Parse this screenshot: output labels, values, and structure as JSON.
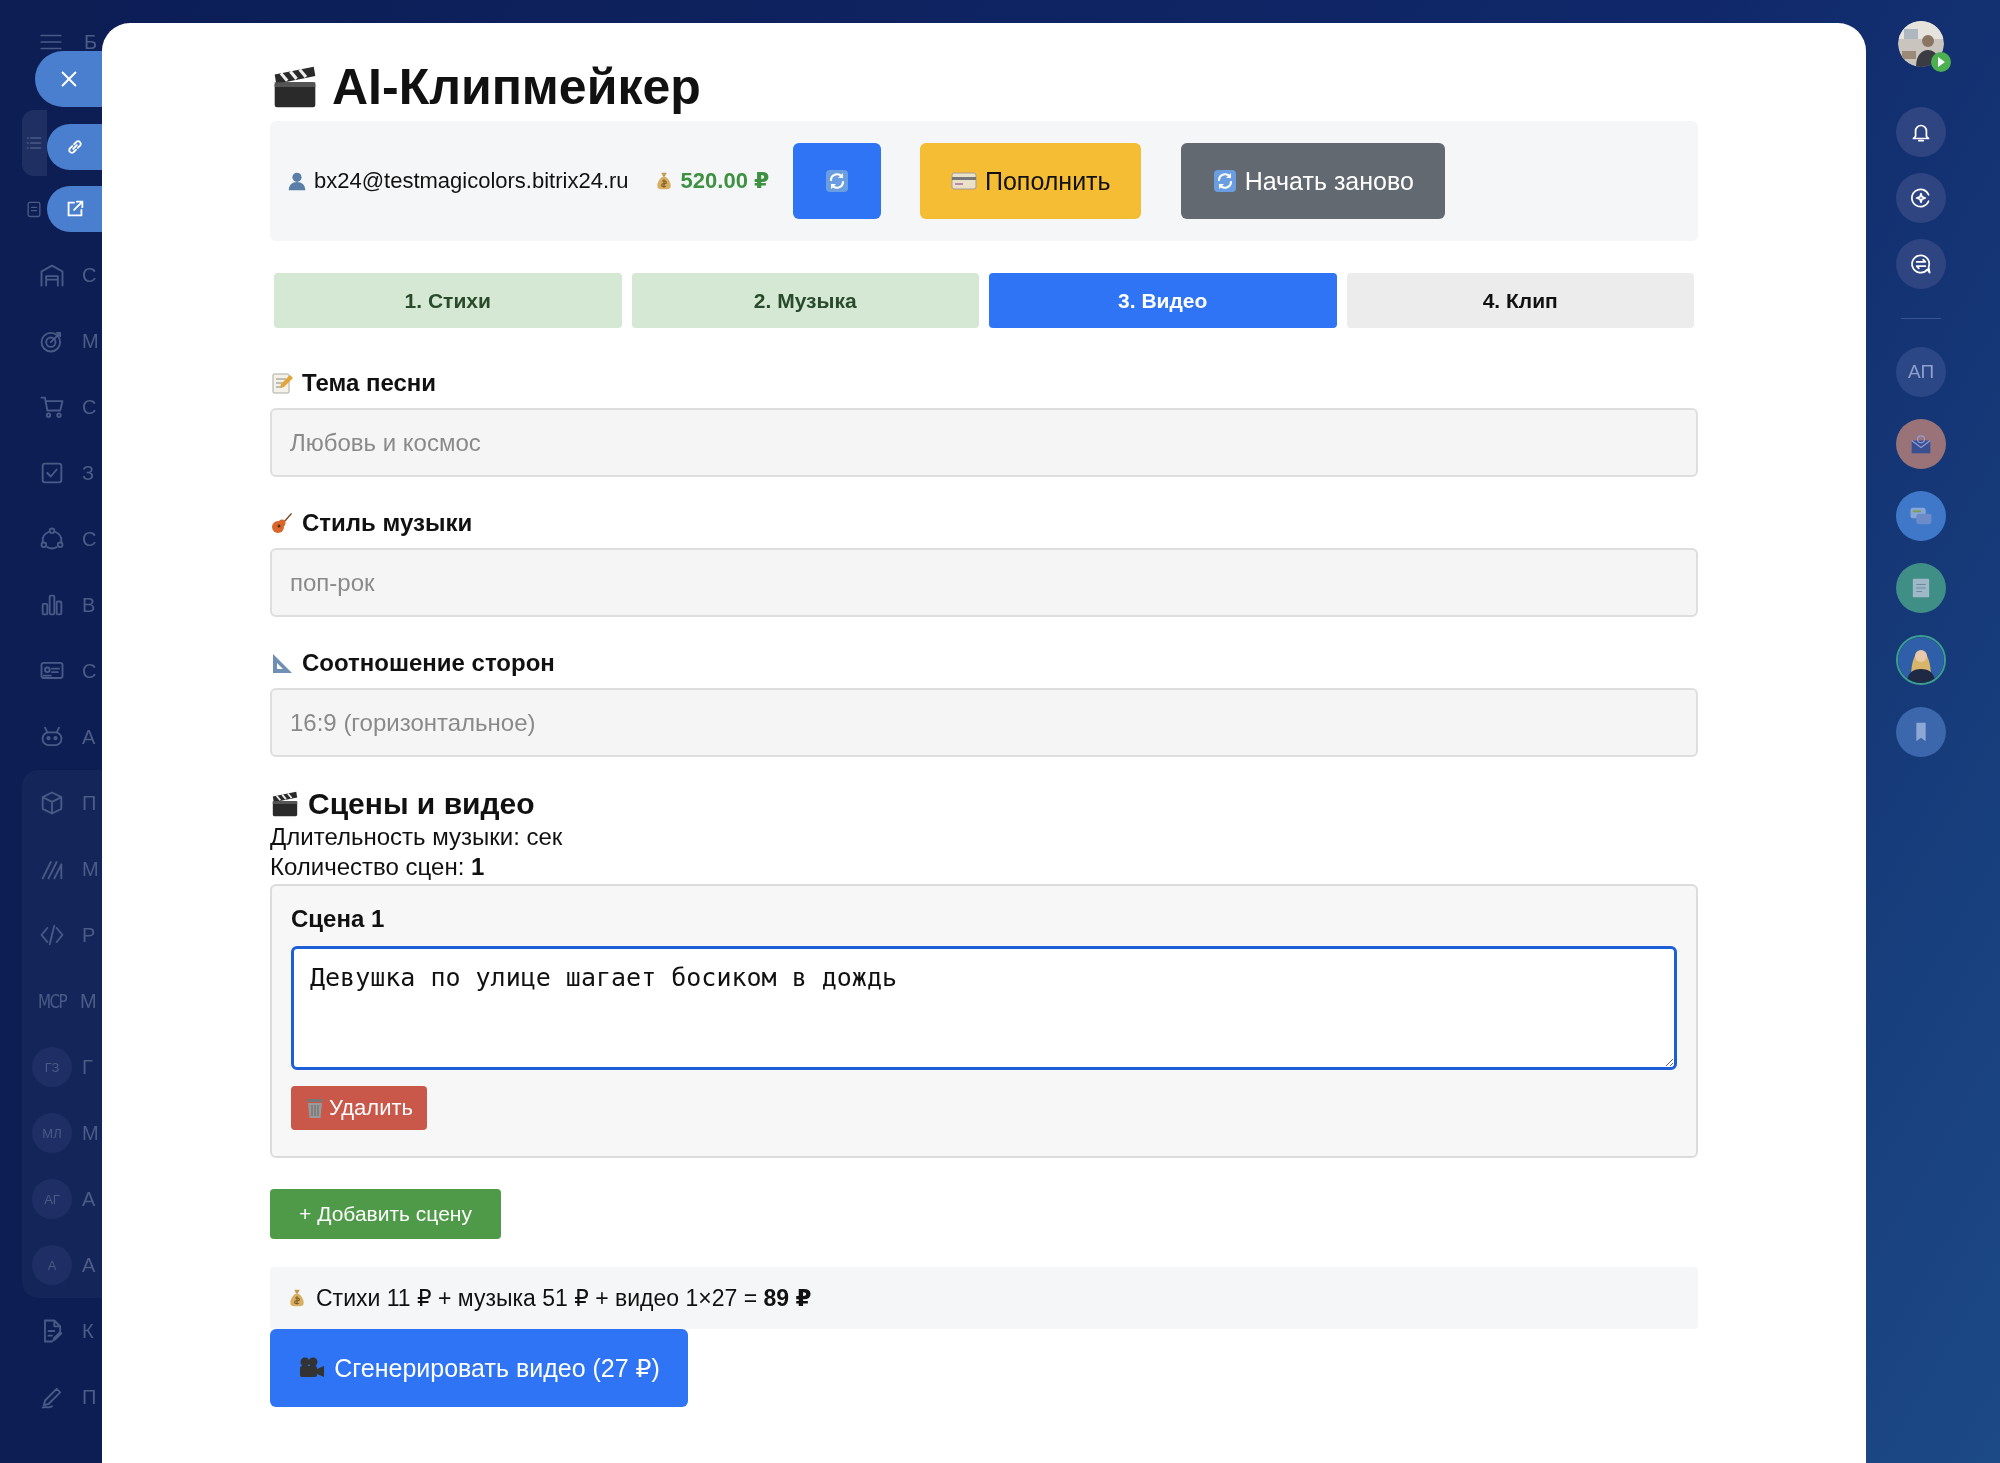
{
  "left_sidebar": {
    "header_label": "Б",
    "items": [
      {
        "kind": "icon",
        "active": true
      },
      {
        "kind": "icon",
        "active": false
      },
      {
        "kind": "icon",
        "label": "С",
        "active": false
      },
      {
        "kind": "icon",
        "label": "М",
        "active": false
      },
      {
        "kind": "icon",
        "label": "С",
        "active": false
      },
      {
        "kind": "icon",
        "label": "З",
        "active": false
      },
      {
        "kind": "icon",
        "label": "С",
        "active": false
      },
      {
        "kind": "icon",
        "label": "В",
        "active": false
      },
      {
        "kind": "icon",
        "label": "С",
        "active": false
      },
      {
        "kind": "icon",
        "label": "А",
        "active": false
      }
    ],
    "group_items": [
      {
        "kind": "icon",
        "label": "П"
      },
      {
        "kind": "icon",
        "label": "М"
      },
      {
        "kind": "icon",
        "label": "Р"
      },
      {
        "kind": "mark",
        "mark": "MCP",
        "label": "М"
      },
      {
        "kind": "initials",
        "initials": "ГЗ",
        "label": "Г"
      },
      {
        "kind": "initials",
        "initials": "МЛ",
        "label": "М"
      },
      {
        "kind": "initials",
        "initials": "АГ",
        "label": "А"
      },
      {
        "kind": "initials",
        "initials": "А",
        "label": "А"
      }
    ],
    "bottom_items": [
      {
        "kind": "icon",
        "label": "К"
      },
      {
        "kind": "icon",
        "label": "П"
      }
    ]
  },
  "right_sidebar": {
    "items": [
      {
        "kind": "avatar"
      },
      {
        "kind": "icon"
      },
      {
        "kind": "icon"
      },
      {
        "kind": "icon"
      },
      {
        "kind": "divider"
      },
      {
        "kind": "initials",
        "initials": "АП"
      },
      {
        "kind": "app",
        "color": "#9a7378"
      },
      {
        "kind": "app",
        "color": "#3f78c8"
      },
      {
        "kind": "app",
        "color": "#3f8f86"
      },
      {
        "kind": "avatar"
      },
      {
        "kind": "app",
        "color": "#3d67ad"
      }
    ]
  },
  "title": "AI-Клипмейкер",
  "account": {
    "email": "bx24@testmagicolors.bitrix24.ru",
    "balance": "520.00 ₽",
    "topup_label": "Пополнить",
    "restart_label": "Начать заново"
  },
  "tabs": [
    {
      "label": "1. Стихи",
      "completed": true,
      "selected": false
    },
    {
      "label": "2. Музыка",
      "completed": true,
      "selected": false
    },
    {
      "label": "3. Видео",
      "completed": false,
      "selected": true
    },
    {
      "label": "4. Клип",
      "completed": false,
      "selected": false
    }
  ],
  "fields": [
    {
      "kind": "text",
      "label": "Тема песни",
      "placeholder": "Любовь и космос"
    },
    {
      "kind": "text",
      "label": "Стиль музыки",
      "placeholder": "поп-рок"
    },
    {
      "kind": "select",
      "label": "Соотношение сторон",
      "value": "16:9 (горизонтальное)"
    }
  ],
  "scenes": {
    "title": "Сцены и видео",
    "duration": "Длительность музыки: сек",
    "count": "Количество сцен: **1**",
    "items": [
      {
        "title": "Сцена 1",
        "text": "Девушка по улице шагает босиком в дождь",
        "focused": true,
        "delete_label": "Удалить"
      }
    ],
    "add_label": "+ Добавить сцену"
  },
  "cost": "Стихи 11 ₽ + музыка 51 ₽ + видео 1×27 = **89 ₽**",
  "generate_label": "Сгенерировать видео (27 ₽)"
}
